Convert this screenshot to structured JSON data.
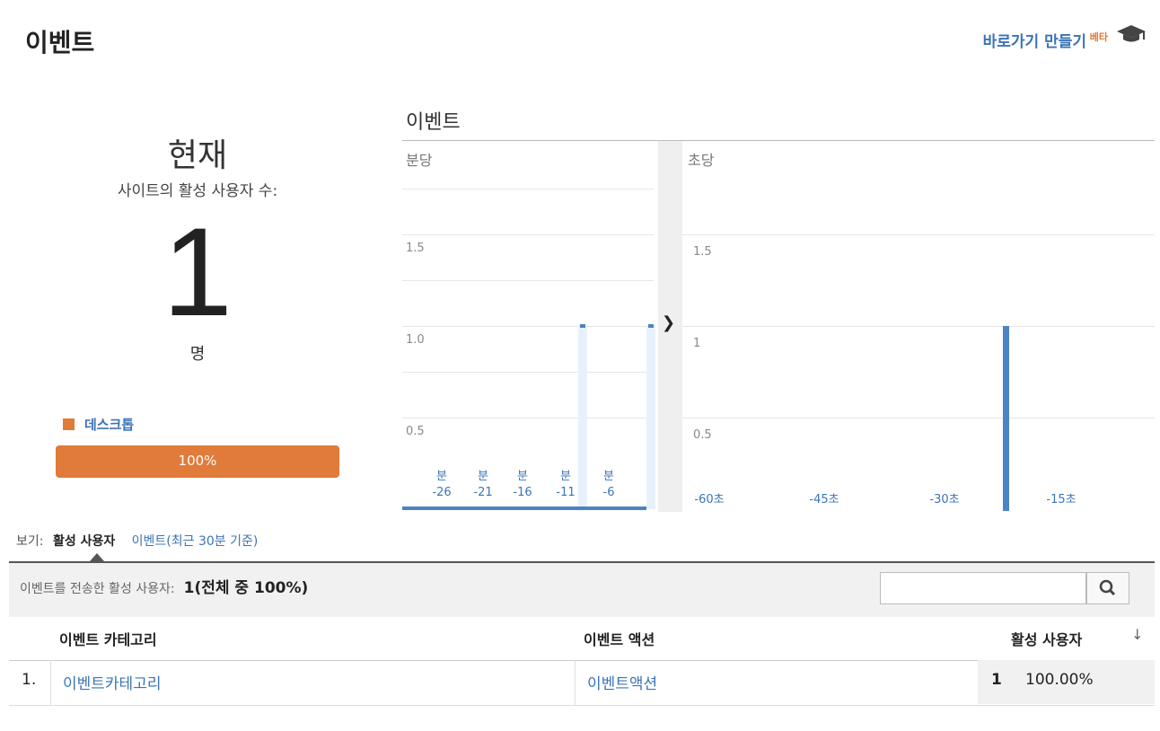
{
  "header": {
    "title": "이벤트",
    "shortcut_label": "바로가기 만들기",
    "beta_label": "베타",
    "icon": "graduation-cap-icon"
  },
  "now": {
    "title": "현재",
    "subtitle": "사이트의 활성 사용자 수:",
    "count": "1",
    "unit": "명"
  },
  "device": {
    "label": "데스크톱",
    "percent_label": "100%",
    "percent": 100,
    "color": "#e07b39"
  },
  "chart": {
    "title": "이벤트",
    "per_minute": {
      "label": "분당",
      "y_labels": [
        "1.5",
        "1.0",
        "0.5"
      ],
      "x_labels": [
        "-26",
        "-21",
        "-16",
        "-11",
        "-6"
      ],
      "x_unit": "분"
    },
    "per_second": {
      "label": "초당",
      "y_labels": [
        "1.5",
        "1",
        "0.5"
      ],
      "x_labels": [
        "-60초",
        "-45초",
        "-30초",
        "-15초"
      ]
    },
    "expand_icon": "chevron-right-icon"
  },
  "chart_data": [
    {
      "type": "bar",
      "title": "분당",
      "x": [
        -26,
        -21,
        -16,
        -11,
        -6
      ],
      "values_note": "",
      "ylim": [
        0,
        2
      ],
      "bars": [
        {
          "x": -11,
          "value": 1
        },
        {
          "x": -6,
          "value": 1
        }
      ]
    },
    {
      "type": "bar",
      "title": "초당",
      "x": [
        -60,
        -45,
        -30,
        -15
      ],
      "ylim": [
        0,
        2
      ],
      "bars": [
        {
          "x": -25,
          "value": 1
        }
      ]
    }
  ],
  "view": {
    "label": "보기:",
    "active_tab": "활성 사용자",
    "other_tab": "이벤트(최근 30분 기준)"
  },
  "summary": {
    "label": "이벤트를 전송한 활성 사용자:",
    "value": "1(전체 중 100%)",
    "search_icon": "search-icon"
  },
  "table": {
    "headers": [
      "이벤트 카테고리",
      "이벤트 액션",
      "활성 사용자"
    ],
    "sort_icon": "arrow-down-icon",
    "rows": [
      {
        "num": "1.",
        "category": "이벤트카테고리",
        "action": "이벤트액션",
        "users": "1",
        "percent": "100.00%"
      }
    ]
  }
}
